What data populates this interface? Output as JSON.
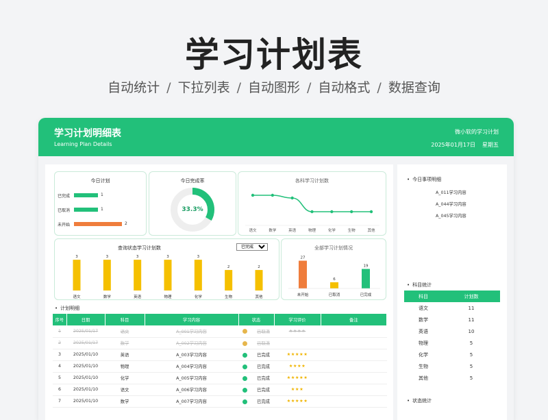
{
  "hero": {
    "title": "学习计划表",
    "features": [
      "自动统计",
      "下拉列表",
      "自动图形",
      "自动格式",
      "数据查询"
    ],
    "separator": "/"
  },
  "header": {
    "title": "学习计划明细表",
    "subtitle": "Learning Plan Details",
    "author": "微小软的学习计划",
    "date": "2025年01月17日",
    "weekday": "星期五"
  },
  "colors": {
    "accent": "#22c07a",
    "done": "#22c07a",
    "cancelled": "#e6b64c",
    "notstarted": "#ef7d3c",
    "bar": "#f5c000"
  },
  "today_plan": {
    "title": "今日计划",
    "rows": [
      {
        "label": "已完成",
        "value": 1,
        "color": "#22c07a"
      },
      {
        "label": "已取消",
        "value": 1,
        "color": "#22c07a"
      },
      {
        "label": "未开始",
        "value": 2,
        "color": "#ef7d3c"
      }
    ]
  },
  "completion": {
    "title": "今日完成率",
    "value_text": "33.3%",
    "fraction": 0.333
  },
  "subject_line": {
    "title": "各科学习计划数",
    "chart_data": {
      "type": "line",
      "categories": [
        "语文",
        "数学",
        "英语",
        "物理",
        "化学",
        "生物",
        "其他"
      ],
      "values": [
        11,
        11,
        10,
        5,
        5,
        5,
        5
      ],
      "ylim": [
        0,
        14
      ],
      "grid": false
    }
  },
  "status_query": {
    "title": "查询状态学习计划数",
    "filter_value": "已完成",
    "chart_data": {
      "type": "bar",
      "categories": [
        "语文",
        "数学",
        "英语",
        "物理",
        "化学",
        "生物",
        "其他"
      ],
      "values": [
        3,
        3,
        3,
        3,
        3,
        2,
        2
      ],
      "ylim": [
        0,
        4
      ]
    }
  },
  "all_status": {
    "title": "全部学习计划情况",
    "chart_data": {
      "type": "bar",
      "categories": [
        "未开始",
        "已取消",
        "已完成"
      ],
      "values": [
        27,
        6,
        19
      ],
      "colors": [
        "#ef7d3c",
        "#f5c000",
        "#22c07a"
      ],
      "ylim": [
        0,
        32
      ]
    }
  },
  "plan_table": {
    "section_label": "计划明细",
    "columns": [
      "序号",
      "日期",
      "科目",
      "学习内容",
      "状态",
      "学习评价",
      "备注"
    ],
    "rows": [
      {
        "no": "1",
        "date": "2025/01/17",
        "subject": "语文",
        "content": "A_001学习内容",
        "status": "已取消",
        "rating": "★★★★",
        "note": "",
        "state": "cancelled"
      },
      {
        "no": "2",
        "date": "2025/01/17",
        "subject": "数学",
        "content": "A_002学习内容",
        "status": "已取消",
        "rating": "",
        "note": "",
        "state": "cancelled"
      },
      {
        "no": "3",
        "date": "2025/01/10",
        "subject": "英语",
        "content": "A_003学习内容",
        "status": "已完成",
        "rating": "★★★★★",
        "note": "",
        "state": "done"
      },
      {
        "no": "4",
        "date": "2025/01/10",
        "subject": "物理",
        "content": "A_004学习内容",
        "status": "已完成",
        "rating": "★★★★",
        "note": "",
        "state": "done"
      },
      {
        "no": "5",
        "date": "2025/01/10",
        "subject": "化学",
        "content": "A_005学习内容",
        "status": "已完成",
        "rating": "★★★★★",
        "note": "",
        "state": "done"
      },
      {
        "no": "6",
        "date": "2025/01/10",
        "subject": "语文",
        "content": "A_006学习内容",
        "status": "已完成",
        "rating": "★★★",
        "note": "",
        "state": "done"
      },
      {
        "no": "7",
        "date": "2025/01/10",
        "subject": "数学",
        "content": "A_007学习内容",
        "status": "已完成",
        "rating": "★★★★★",
        "note": "",
        "state": "done"
      }
    ]
  },
  "todo": {
    "section_label": "今日事项明细",
    "items": [
      "A_011学习内容",
      "A_044学习内容",
      "A_045学习内容"
    ]
  },
  "subject_stats": {
    "section_label": "科目统计",
    "columns": [
      "科目",
      "计划数"
    ],
    "rows": [
      [
        "语文",
        "11"
      ],
      [
        "数学",
        "11"
      ],
      [
        "英语",
        "10"
      ],
      [
        "物理",
        "5"
      ],
      [
        "化学",
        "5"
      ],
      [
        "生物",
        "5"
      ],
      [
        "其他",
        "5"
      ]
    ]
  },
  "status_stats": {
    "section_label": "状态统计"
  }
}
